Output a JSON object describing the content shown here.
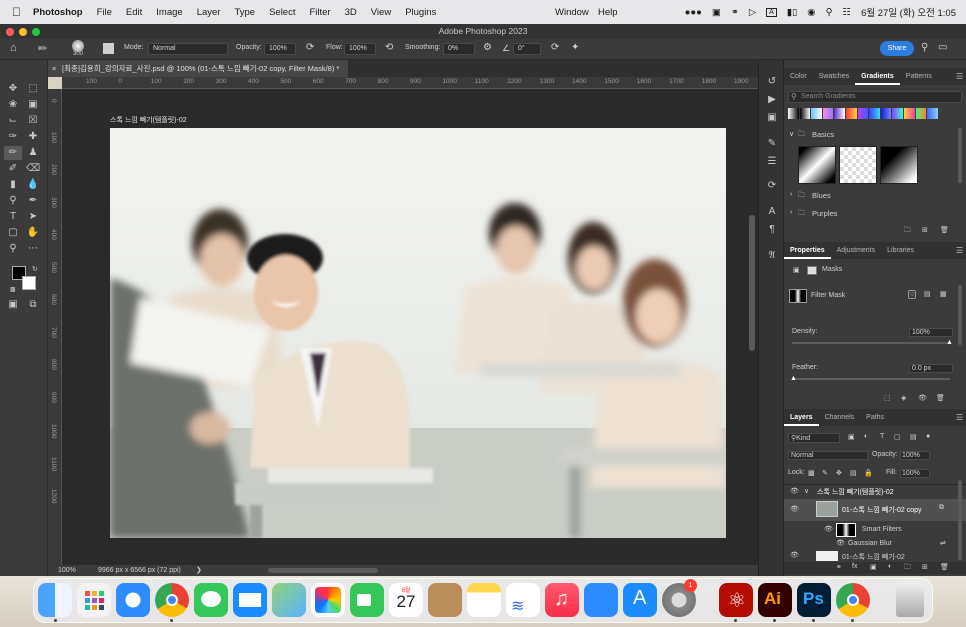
{
  "menubar": {
    "app": "Photoshop",
    "items": [
      "File",
      "Edit",
      "Image",
      "Layer",
      "Type",
      "Select",
      "Filter",
      "3D",
      "View",
      "Plugins"
    ],
    "right_items": [
      "Window",
      "Help"
    ],
    "datetime": "6월 27일 (화) 오전 1:05"
  },
  "window": {
    "title": "Adobe Photoshop 2023"
  },
  "options": {
    "brush_size": "300",
    "mode_label": "Mode:",
    "mode_value": "Normal",
    "opacity_label": "Opacity:",
    "opacity_value": "100%",
    "flow_label": "Flow:",
    "flow_value": "100%",
    "smoothing_label": "Smoothing:",
    "smoothing_value": "0%",
    "angle_value": "0°",
    "share_label": "Share"
  },
  "document": {
    "tab_title": "[최종]김용희_강의자료_사진.psd @ 100% (01-스톡 느낌 빼기-02 copy, Filter Mask/8) *",
    "artboard_label": "스톡 느낌 빼기(템플릿)-02",
    "zoom": "100%",
    "doc_info": "9966 px x 6566 px (72 ppi)",
    "ruler_h": [
      "100",
      "0",
      "100",
      "200",
      "300",
      "400",
      "500",
      "600",
      "700",
      "800",
      "900",
      "1000",
      "1100",
      "1200",
      "1300",
      "1400",
      "1500",
      "1600",
      "1700",
      "1800",
      "1900"
    ],
    "ruler_v": [
      "0",
      "100",
      "200",
      "300",
      "400",
      "500",
      "600",
      "700",
      "800",
      "900",
      "1000",
      "1100",
      "1200"
    ]
  },
  "gradients_panel": {
    "tabs": [
      "Color",
      "Swatches",
      "Gradients",
      "Patterns"
    ],
    "active_tab": "Gradients",
    "search_placeholder": "Search Gradients",
    "groups": [
      "Basics",
      "Blues",
      "Purples"
    ]
  },
  "properties_panel": {
    "tabs": [
      "Properties",
      "Adjustments",
      "Libraries"
    ],
    "active_tab": "Properties",
    "masks_label": "Masks",
    "filter_mask_label": "Filter Mask",
    "density_label": "Density:",
    "density_value": "100%",
    "density_fraction": 1.0,
    "feather_label": "Feather:",
    "feather_value": "0.0 px",
    "feather_fraction": 0.0
  },
  "layers_panel": {
    "tabs": [
      "Layers",
      "Channels",
      "Paths"
    ],
    "active_tab": "Layers",
    "filter_kind": "Kind",
    "blend_mode": "Normal",
    "opacity_label": "Opacity:",
    "opacity_value": "100%",
    "lock_label": "Lock:",
    "fill_label": "Fill:",
    "fill_value": "100%",
    "layers": [
      {
        "name": "스톡 느낌 빼기(템플릿)-02"
      },
      {
        "name": "01-스톡 느낌 빼기-02 copy"
      },
      {
        "name": "Smart Filters"
      },
      {
        "name": "Gaussian Blur"
      },
      {
        "name": "01-스톡 느낌 빼기-02"
      }
    ]
  },
  "dock": {
    "calendar_month": "6월",
    "calendar_day": "27",
    "badge_count": "1",
    "illustrator_label": "Ai",
    "photoshop_label": "Ps"
  }
}
